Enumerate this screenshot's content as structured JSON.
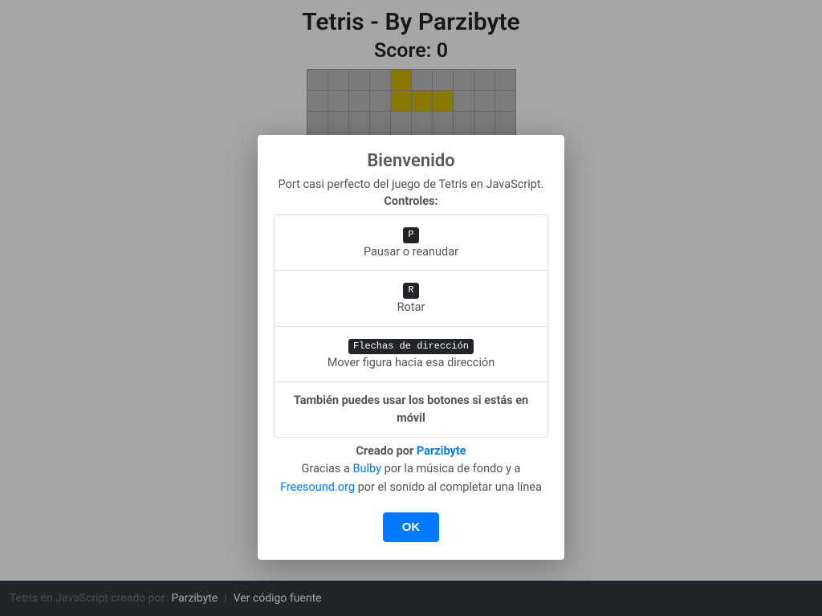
{
  "header": {
    "title": "Tetris - By Parzibyte",
    "score_label": "Score:",
    "score_value": 0
  },
  "board": {
    "cols": 10,
    "visible_rows": 4,
    "filled_cells": [
      {
        "row": 0,
        "col": 4
      },
      {
        "row": 1,
        "col": 4
      },
      {
        "row": 1,
        "col": 5
      },
      {
        "row": 1,
        "col": 6
      }
    ],
    "colors": {
      "empty": "#bdbdbd",
      "grid": "#9e9e9e",
      "piece": "#d6b900"
    }
  },
  "modal": {
    "title": "Bienvenido",
    "description": "Port casi perfecto del juego de Tetris en JavaScript.",
    "controls_heading": "Controles:",
    "controls": [
      {
        "key": "P",
        "label": "Pausar o reanudar"
      },
      {
        "key": "R",
        "label": "Rotar"
      },
      {
        "key": "Flechas de dirección",
        "label": "Mover figura hacia esa dirección"
      }
    ],
    "mobile_note": "También puedes usar los botones si estás en móvil",
    "credits": {
      "created_prefix": "Creado por ",
      "created_link": "Parzibyte",
      "thanks_prefix": "Gracias a ",
      "thanks1_link": "Bulby",
      "thanks1_suffix": " por la música de fondo y a ",
      "thanks2_link": "Freesound.org",
      "thanks2_suffix": " por el sonido al completar una línea"
    },
    "ok_label": "OK"
  },
  "footer": {
    "prefix": "Tetris en JavaScript creado por ",
    "author": "Parzibyte",
    "source_link": "Ver código fuente"
  }
}
